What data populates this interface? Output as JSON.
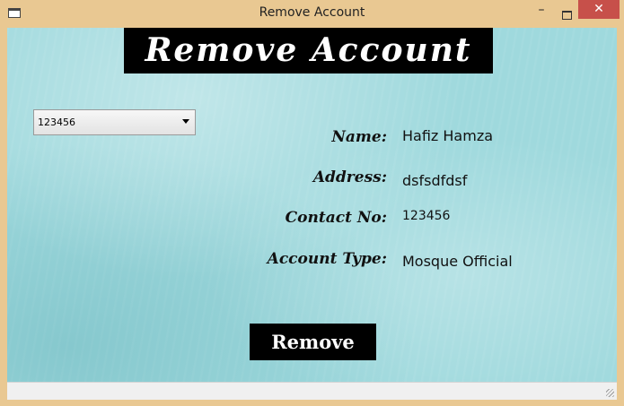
{
  "window": {
    "title": "Remove Account",
    "minimize_glyph": "–",
    "close_glyph": "✕"
  },
  "header": {
    "banner": "Remove Account"
  },
  "account_selector": {
    "selected": "123456"
  },
  "details": {
    "name_label": "Name:",
    "name_value": "Hafiz Hamza",
    "address_label": "Address:",
    "address_value": "dsfsdfdsf",
    "contact_label": "Contact No:",
    "contact_value": "123456",
    "type_label": "Account Type:",
    "type_value": "Mosque Official"
  },
  "actions": {
    "remove_label": "Remove"
  },
  "colors": {
    "background": "#9fd9dd",
    "banner_bg": "#000000",
    "close_button": "#c7504a",
    "window_frame": "#e9c892"
  }
}
